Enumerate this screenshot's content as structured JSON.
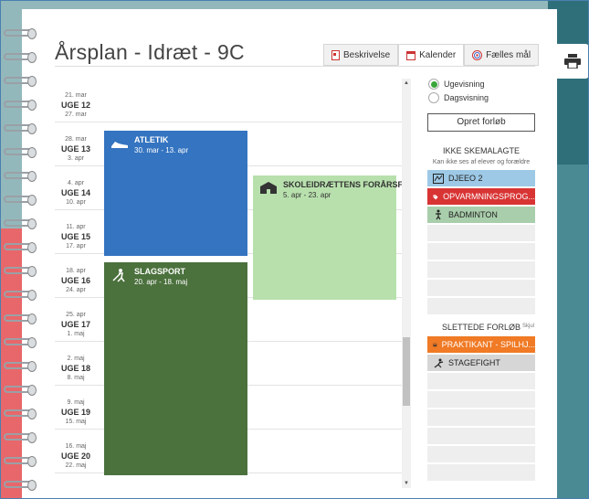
{
  "title": "Årsplan - Idræt - 9C",
  "tabs": [
    {
      "label": "Beskrivelse",
      "icon": "document-icon"
    },
    {
      "label": "Kalender",
      "icon": "calendar-icon"
    },
    {
      "label": "Fælles mål",
      "icon": "target-icon"
    }
  ],
  "calendar": {
    "weeks": [
      {
        "start": "21. mar",
        "label": "UGE 12",
        "end": "27. mar"
      },
      {
        "start": "28. mar",
        "label": "UGE 13",
        "end": "3. apr"
      },
      {
        "start": "4. apr",
        "label": "UGE 14",
        "end": "10. apr"
      },
      {
        "start": "11. apr",
        "label": "UGE 15",
        "end": "17. apr"
      },
      {
        "start": "18. apr",
        "label": "UGE 16",
        "end": "24. apr"
      },
      {
        "start": "25. apr",
        "label": "UGE 17",
        "end": "1. maj"
      },
      {
        "start": "2. maj",
        "label": "UGE 18",
        "end": "8. maj"
      },
      {
        "start": "9. maj",
        "label": "UGE 19",
        "end": "15. maj"
      },
      {
        "start": "16. maj",
        "label": "UGE 20",
        "end": "22. maj"
      }
    ],
    "blocks": [
      {
        "name": "ATLETIK",
        "dates": "30. mar - 13. apr",
        "color": "#3474c0",
        "icon": "running-shoe-icon"
      },
      {
        "name": "SKOLEIDRÆTTENS FORÅRSFE...",
        "dates": "5. apr - 23. apr",
        "color": "#b8e0ad",
        "icon": "school-icon"
      },
      {
        "name": "SLAGSPORT",
        "dates": "20. apr - 18. maj",
        "color": "#4b713d",
        "icon": "hockey-icon"
      }
    ]
  },
  "view": {
    "options": [
      "Ugevisning",
      "Dagsvisning"
    ],
    "selected": "Ugevisning"
  },
  "create_button": "Opret forløb",
  "unscheduled": {
    "title": "IKKE SKEMALAGTE",
    "subtitle": "Kan ikke ses af elever og forældre",
    "items": [
      {
        "label": "DJEEO 2",
        "color": "#9dc9e6",
        "icon": "map-icon"
      },
      {
        "label": "OPVARMNINGSPROG...",
        "color": "#d83434",
        "icon": "tag-icon"
      },
      {
        "label": "BADMINTON",
        "color": "#a9ceab",
        "icon": "badminton-icon"
      }
    ]
  },
  "deleted": {
    "title": "SLETTEDE FORLØB",
    "hide_label": "Skjul",
    "items": [
      {
        "label": "PRAKTIKANT - SPILHJ...",
        "color": "#f07a25",
        "icon": "bus-icon"
      },
      {
        "label": "STAGEFIGHT",
        "color": "#d6d6d6",
        "icon": "fighter-icon"
      }
    ]
  }
}
